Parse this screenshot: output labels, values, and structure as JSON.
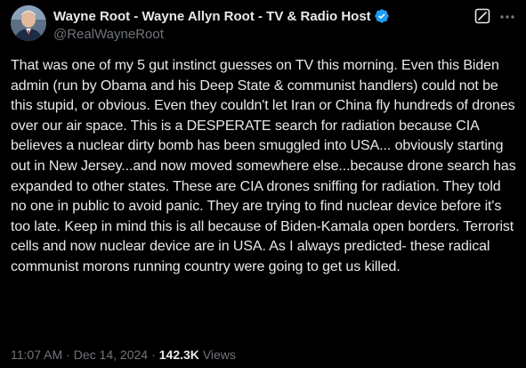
{
  "author": {
    "display_name": "Wayne Root - Wayne Allyn Root - TV & Radio Host",
    "handle": "@RealWayneRoot",
    "avatar_icon": "profile-photo",
    "verified_icon": "verified-badge-icon"
  },
  "actions": {
    "grok_icon": "grok-icon",
    "more_icon": "more-options-icon"
  },
  "tweet": {
    "text": "That was one of my 5 gut instinct guesses on TV this morning. Even this Biden admin (run by Obama and his Deep State & communist handlers) could not be this stupid, or obvious. Even they couldn't let Iran or China fly hundreds of drones over our air space. This is a DESPERATE search for radiation because CIA believes a nuclear dirty bomb has been smuggled into USA... obviously starting out in New Jersey...and now moved somewhere else...because drone search has expanded to other states. These are CIA drones sniffing for radiation. They told no one in public to avoid panic. They are trying to find nuclear device before it's too late. Keep in mind this is all because of Biden-Kamala open borders. Terrorist cells and now nuclear device are in USA. As I always predicted- these radical communist morons running country were going to get us killed."
  },
  "meta": {
    "time": "11:07 AM",
    "date": "Dec 14, 2024",
    "separator": "·",
    "views_count": "142.3K",
    "views_label": "Views"
  },
  "colors": {
    "background": "#000000",
    "text": "#e7e9ea",
    "secondary": "#71767b",
    "verified": "#1d9bf0"
  }
}
